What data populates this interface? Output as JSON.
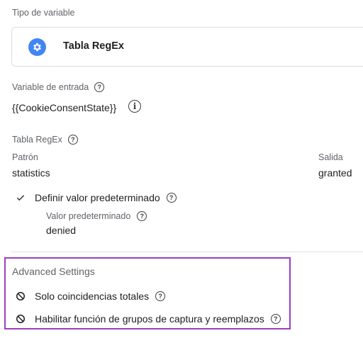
{
  "variable_type": {
    "section_label": "Tipo de variable",
    "card_title": "Tabla RegEx",
    "card_icon": "gear-icon"
  },
  "input_variable": {
    "label": "Variable de entrada",
    "value": "{{CookieConsentState}}"
  },
  "regex_table": {
    "label": "Tabla RegEx",
    "pattern_header": "Patrón",
    "output_header": "Salida",
    "rows": [
      {
        "pattern": "statistics",
        "output": "granted"
      }
    ]
  },
  "default_value": {
    "checkbox_label": "Definir valor predeterminado",
    "checked": true,
    "value_label": "Valor predeterminado",
    "value": "denied"
  },
  "advanced_settings": {
    "title": "Advanced Settings",
    "highlight_color": "#9c3ebd",
    "options": [
      {
        "label": "Solo coincidencias totales",
        "enabled": false
      },
      {
        "label": "Habilitar función de grupos de captura y reemplazos",
        "enabled": false
      }
    ]
  },
  "colors": {
    "accent_blue": "#4285f4",
    "text_primary": "#202124",
    "text_secondary": "#5f6368"
  }
}
